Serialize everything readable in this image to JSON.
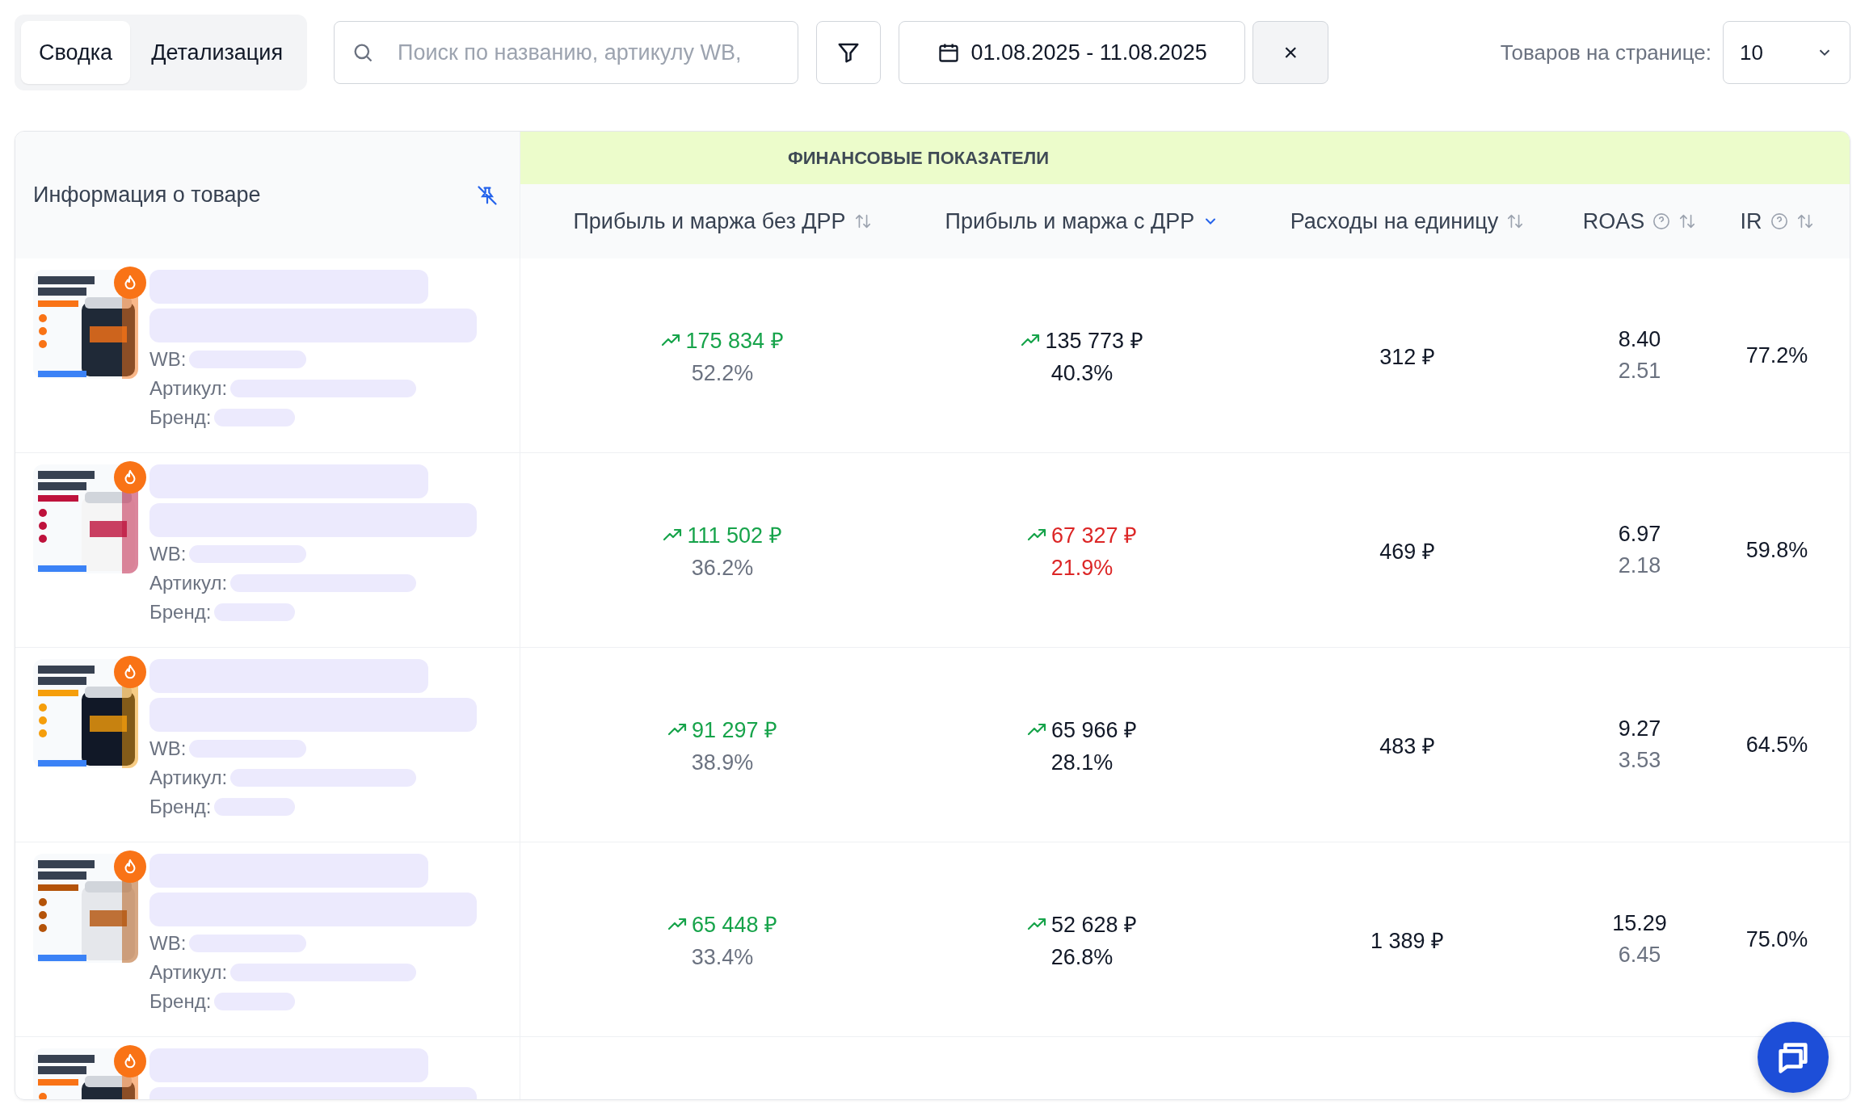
{
  "view_tabs": [
    {
      "label": "Сводка",
      "selected": true
    },
    {
      "label": "Детализация",
      "selected": false
    }
  ],
  "search": {
    "placeholder": "Поиск по названию, артикулу WB,"
  },
  "date_range": {
    "value": "01.08.2025 - 11.08.2025"
  },
  "clear_button": {
    "label": "×"
  },
  "page_size": {
    "label": "Товаров на странице:",
    "value": "10"
  },
  "table": {
    "product_header": "Информация о товаре",
    "group_header": "ФИНАНСОВЫЕ ПОКАЗАТЕЛИ",
    "columns": [
      {
        "label": "Прибыль и маржа без ДРР",
        "help": false,
        "sorted": false
      },
      {
        "label": "Прибыль и маржа с ДРР",
        "help": false,
        "sorted": true
      },
      {
        "label": "Расходы на единицу",
        "help": false,
        "sorted": false
      },
      {
        "label": "ROAS",
        "help": true,
        "sorted": false
      },
      {
        "label": "IR",
        "help": true,
        "sorted": false
      }
    ],
    "rows": [
      {
        "kind": "full",
        "hot": true,
        "fields": [
          "WB:",
          "Артикул:",
          "Бренд:"
        ],
        "profit": {
          "value": "175 834 ₽",
          "percent": "52.2%",
          "kind": "gain"
        },
        "profit_drr": {
          "value": "135 773 ₽",
          "percent": "40.3%",
          "kind": "plain"
        },
        "unit_cost": "312 ₽",
        "roas": {
          "main": "8.40",
          "sub": "2.51"
        },
        "ir": "77.2%"
      },
      {
        "kind": "full",
        "hot": true,
        "fields": [
          "WB:",
          "Артикул:",
          "Бренд:"
        ],
        "profit": {
          "value": "111 502 ₽",
          "percent": "36.2%",
          "kind": "gain"
        },
        "profit_drr": {
          "value": "67 327 ₽",
          "percent": "21.9%",
          "kind": "loss"
        },
        "unit_cost": "469 ₽",
        "roas": {
          "main": "6.97",
          "sub": "2.18"
        },
        "ir": "59.8%"
      },
      {
        "kind": "full",
        "hot": true,
        "fields": [
          "WB:",
          "Артикул:",
          "Бренд:"
        ],
        "profit": {
          "value": "91 297 ₽",
          "percent": "38.9%",
          "kind": "gain"
        },
        "profit_drr": {
          "value": "65 966 ₽",
          "percent": "28.1%",
          "kind": "plain"
        },
        "unit_cost": "483 ₽",
        "roas": {
          "main": "9.27",
          "sub": "3.53"
        },
        "ir": "64.5%"
      },
      {
        "kind": "full",
        "hot": true,
        "fields": [
          "WB:",
          "Артикул:",
          "Бренд:"
        ],
        "profit": {
          "value": "65 448 ₽",
          "percent": "33.4%",
          "kind": "gain"
        },
        "profit_drr": {
          "value": "52 628 ₽",
          "percent": "26.8%",
          "kind": "plain"
        },
        "unit_cost": "1 389 ₽",
        "roas": {
          "main": "15.29",
          "sub": "6.45"
        },
        "ir": "75.0%"
      },
      {
        "kind": "partial",
        "hot": true
      }
    ]
  }
}
